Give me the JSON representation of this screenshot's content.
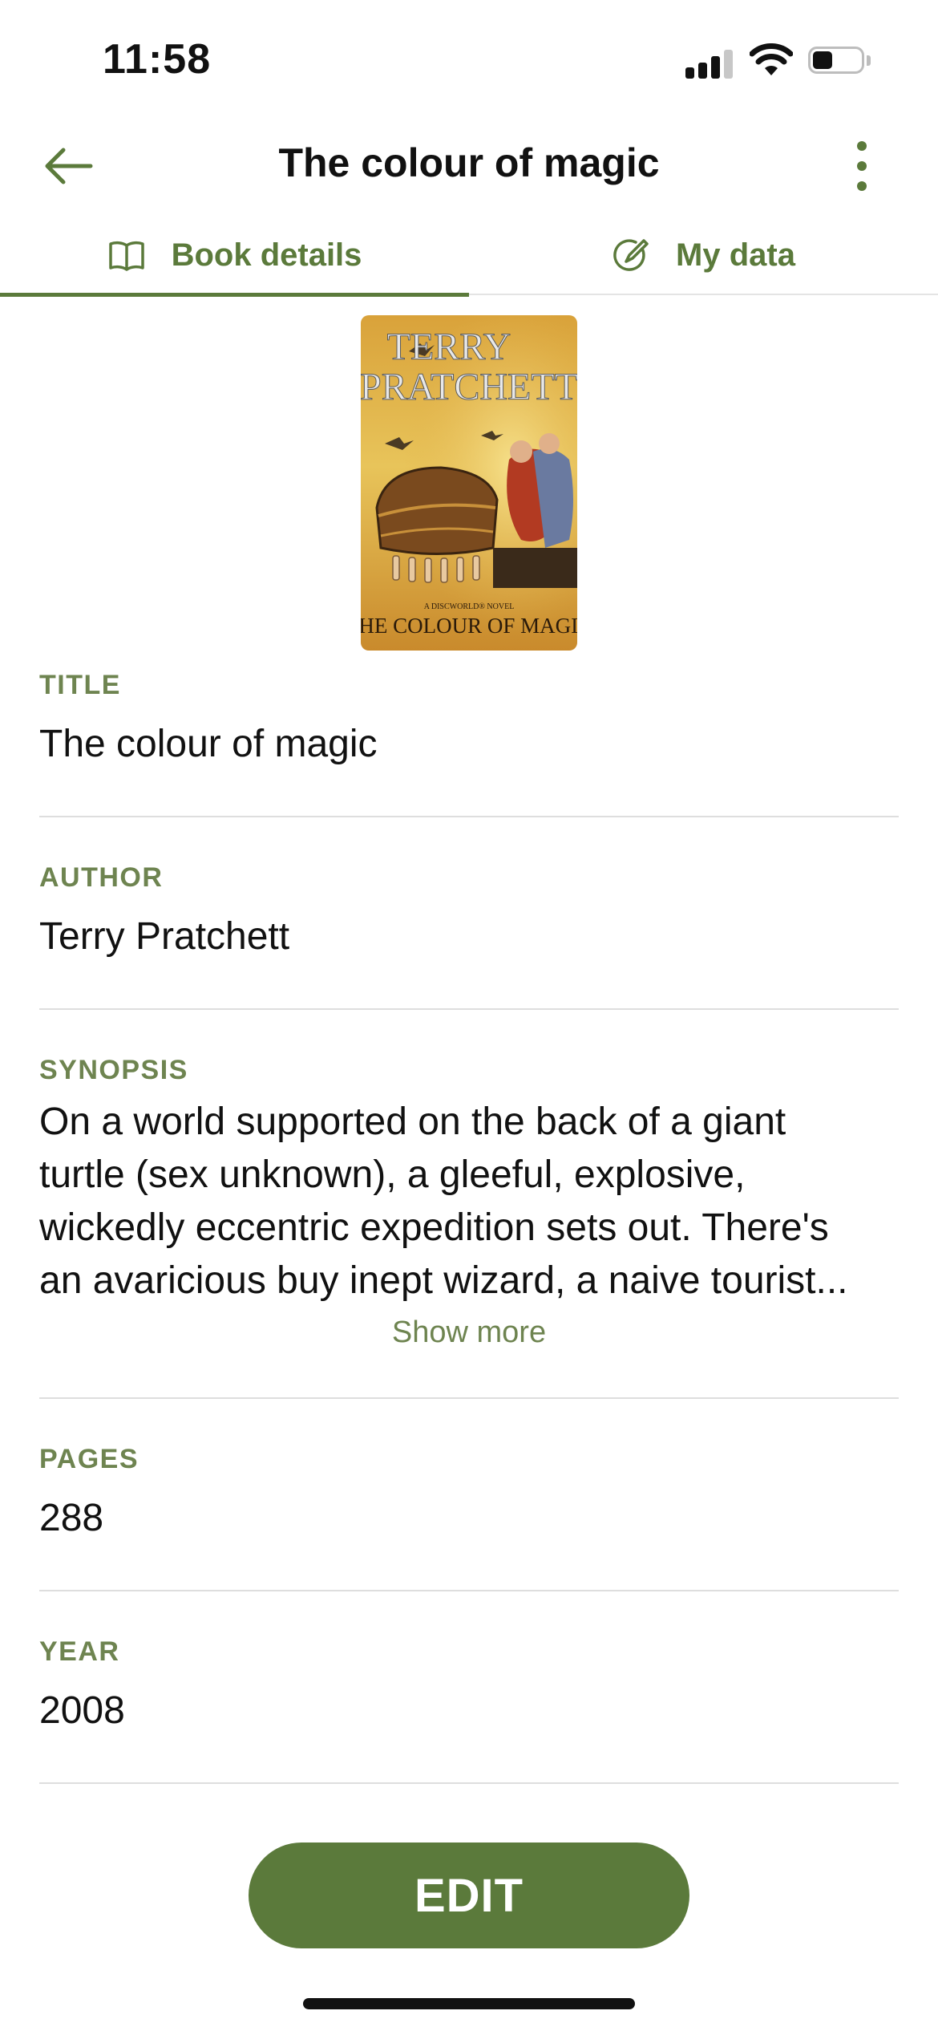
{
  "status_bar": {
    "time": "11:58"
  },
  "header": {
    "title": "The colour of magic"
  },
  "tabs": [
    {
      "label": "Book details",
      "active": true
    },
    {
      "label": "My data",
      "active": false
    }
  ],
  "cover": {
    "author_text": "TERRY PRATCHETT",
    "subtitle": "A DISCWORLD® NOVEL",
    "title_text": "THE COLOUR OF MAGIC"
  },
  "fields": {
    "title": {
      "label": "TITLE",
      "value": "The colour of magic"
    },
    "author": {
      "label": "AUTHOR",
      "value": "Terry Pratchett"
    },
    "synopsis": {
      "label": "SYNOPSIS",
      "lines": [
        "On a world supported on the back of a giant",
        "turtle (sex unknown), a gleeful, explosive,",
        "wickedly eccentric expedition sets out. There's",
        "an avaricious buy inept wizard, a naive tourist..."
      ],
      "show_more": "Show more"
    },
    "pages": {
      "label": "PAGES",
      "value": "288"
    },
    "year": {
      "label": "YEAR",
      "value": "2008"
    }
  },
  "actions": {
    "edit_label": "EDIT"
  },
  "colors": {
    "accent": "#5b7a3b",
    "label": "#6e8450"
  }
}
